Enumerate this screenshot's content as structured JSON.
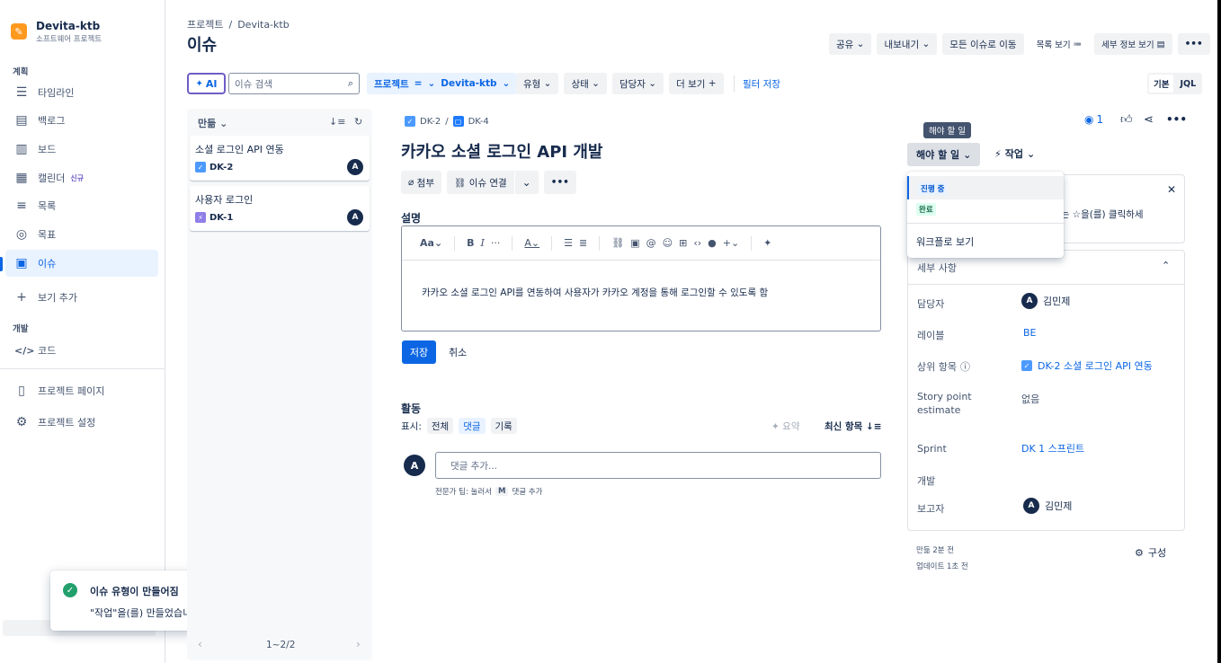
{
  "sidebar": {
    "project_name": "Devita-ktb",
    "project_type": "소프트웨어 프로젝트",
    "section_plan": "계획",
    "section_dev": "개발",
    "items": [
      {
        "label": "타임라인",
        "icon": "timeline-icon"
      },
      {
        "label": "백로그",
        "icon": "backlog-icon"
      },
      {
        "label": "보드",
        "icon": "board-icon"
      },
      {
        "label": "캘린더",
        "icon": "calendar-icon",
        "badge": "신규"
      },
      {
        "label": "목록",
        "icon": "list-icon"
      },
      {
        "label": "목표",
        "icon": "goal-icon"
      },
      {
        "label": "이슈",
        "icon": "issues-icon",
        "active": true
      },
      {
        "label": "보기 추가",
        "icon": "plus-icon"
      },
      {
        "label": "코드",
        "icon": "code-icon"
      },
      {
        "label": "프로젝트 페이지",
        "icon": "page-icon"
      },
      {
        "label": "프로젝트 설정",
        "icon": "gear-icon"
      }
    ]
  },
  "toast": {
    "title": "이슈 유형이 만들어짐",
    "message": "\"작업\"을(를) 만들었습니다."
  },
  "header": {
    "breadcrumb_root": "프로젝트",
    "breadcrumb_sep": "/",
    "breadcrumb_project": "Devita-ktb",
    "title": "이슈",
    "share": "공유",
    "export": "내보내기",
    "go_all": "모든 이슈로 이동",
    "list_view": "목록 보기",
    "detail_view": "세부 정보 보기",
    "more": "•••"
  },
  "filters": {
    "ai": "AI",
    "search_placeholder": "이슈 검색",
    "project_label": "프로젝트",
    "project_op": "=",
    "project_value": "Devita-ktb",
    "type": "유형",
    "status": "상태",
    "assignee": "담당자",
    "more": "더 보기",
    "save_filter": "필터 저장",
    "basic": "기본",
    "jql": "JQL"
  },
  "list": {
    "sort_label": "만듦",
    "pagination": "1~2/2",
    "items": [
      {
        "title": "소셜 로그인 API 연동",
        "key": "DK-2",
        "avatar": "A"
      },
      {
        "title": "사용자 로그인",
        "key": "DK-1",
        "avatar": "A"
      }
    ]
  },
  "issue": {
    "parent_key": "DK-2",
    "sep": "/",
    "key": "DK-4",
    "title": "카카오 소셜 로그인 API 개발",
    "attach": "첨부",
    "link_issue": "이슈 연결",
    "description_label": "설명",
    "description": "카카오 소셜 로그인 API를 연동하여 사용자가 카카오 계정을 통해 로그인할 수 있도록 함",
    "toolbar_text": "Aa",
    "save": "저장",
    "cancel": "취소"
  },
  "activity": {
    "title": "활동",
    "show_label": "표시:",
    "tabs": [
      "전체",
      "댓글",
      "기록"
    ],
    "summary": "요약",
    "sort": "최신 항목",
    "comment_placeholder": "댓글 추가...",
    "tip_prefix": "전문가 팁: 눌러서",
    "tip_key": "M",
    "tip_suffix": "댓글 추가",
    "avatar": "A"
  },
  "right": {
    "watch_count": "1",
    "tooltip": "해야 할 일",
    "status": "해야 할 일",
    "action": "작업",
    "dropdown": {
      "in_progress": "진행 중",
      "done": "완료",
      "workflow": "워크플로 보기"
    },
    "pinned_hint": "있는 ☆을(를) 클릭하세",
    "details_title": "세부 사항",
    "fields": {
      "assignee_label": "담당자",
      "assignee": "김민제",
      "labels_label": "레이블",
      "labels": "BE",
      "parent_label": "상위 항목",
      "parent": "DK-2 소셜 로그인 API 연동",
      "story_label_1": "Story point",
      "story_label_2": "estimate",
      "story_value": "없음",
      "sprint_label": "Sprint",
      "sprint": "DK 1 스프린트",
      "dev_label": "개발",
      "reporter_label": "보고자",
      "reporter": "김민제"
    },
    "created": "만듦 2분 전",
    "updated": "업데이트 1초 전",
    "configure": "구성"
  },
  "colors": {
    "primary": "#0c66e4",
    "success": "#22a06b",
    "text": "#172b4d"
  }
}
